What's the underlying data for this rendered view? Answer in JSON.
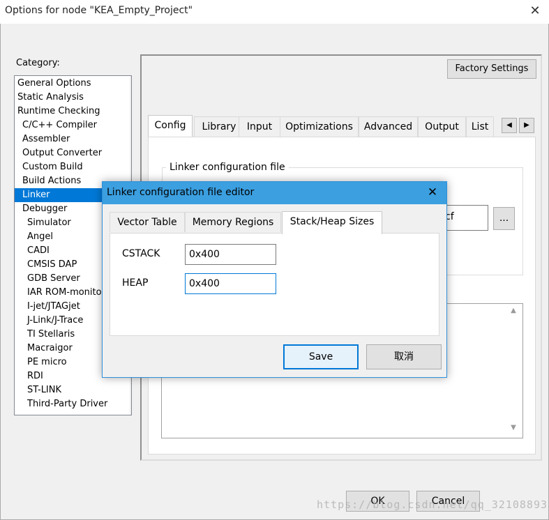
{
  "window": {
    "title": "Options for node \"KEA_Empty_Project\"",
    "close_glyph": "✕"
  },
  "category": {
    "label": "Category:",
    "items": [
      {
        "label": "General Options",
        "indent": 0
      },
      {
        "label": "Static Analysis",
        "indent": 0
      },
      {
        "label": "Runtime Checking",
        "indent": 0
      },
      {
        "label": "C/C++ Compiler",
        "indent": 1
      },
      {
        "label": "Assembler",
        "indent": 1
      },
      {
        "label": "Output Converter",
        "indent": 1
      },
      {
        "label": "Custom Build",
        "indent": 1
      },
      {
        "label": "Build Actions",
        "indent": 1
      },
      {
        "label": "Linker",
        "indent": 1,
        "selected": true
      },
      {
        "label": "Debugger",
        "indent": 1
      },
      {
        "label": "Simulator",
        "indent": 2
      },
      {
        "label": "Angel",
        "indent": 2
      },
      {
        "label": "CADI",
        "indent": 2
      },
      {
        "label": "CMSIS DAP",
        "indent": 2
      },
      {
        "label": "GDB Server",
        "indent": 2
      },
      {
        "label": "IAR ROM-monitor",
        "indent": 2
      },
      {
        "label": "I-jet/JTAGjet",
        "indent": 2
      },
      {
        "label": "J-Link/J-Trace",
        "indent": 2
      },
      {
        "label": "TI Stellaris",
        "indent": 2
      },
      {
        "label": "Macraigor",
        "indent": 2
      },
      {
        "label": "PE micro",
        "indent": 2
      },
      {
        "label": "RDI",
        "indent": 2
      },
      {
        "label": "ST-LINK",
        "indent": 2
      },
      {
        "label": "Third-Party Driver",
        "indent": 2
      }
    ],
    "scroll_up": "▲",
    "scroll_down": "▼"
  },
  "panel": {
    "factory_settings": "Factory Settings",
    "tabs": [
      "Config",
      "Library",
      "Input",
      "Optimizations",
      "Advanced",
      "Output",
      "List"
    ],
    "active_tab": "Config",
    "tab_scroll_left": "◀",
    "tab_scroll_right": "▶",
    "linker_group_title": "Linker configuration file",
    "linker_file_visible": "cf",
    "browse": "...",
    "lower_scroll_up": "▲",
    "lower_scroll_down": "▼"
  },
  "buttons": {
    "ok": "OK",
    "cancel": "Cancel"
  },
  "watermark": "https://blog.csdn.net/qq_32108893",
  "dialog": {
    "title": "Linker configuration file editor",
    "close_glyph": "✕",
    "tabs": [
      "Vector Table",
      "Memory Regions",
      "Stack/Heap Sizes"
    ],
    "active_tab": "Stack/Heap Sizes",
    "cstack_label": "CSTACK",
    "cstack_value": "0x400",
    "heap_label": "HEAP",
    "heap_value": "0x400",
    "save": "Save",
    "cancel": "取消"
  },
  "colors": {
    "selection": "#0078d7",
    "dialog_titlebar": "#3b9fe0",
    "focus_border": "#0078d7"
  }
}
